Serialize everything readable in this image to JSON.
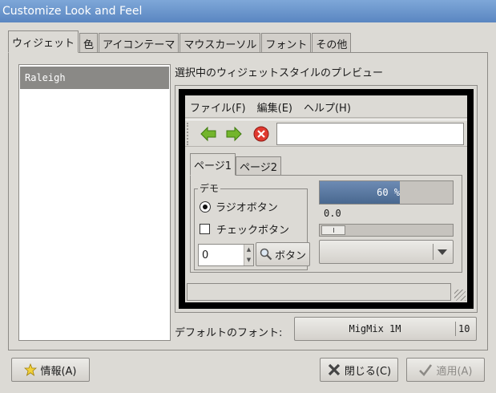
{
  "window": {
    "title": "Customize Look and Feel"
  },
  "tabs": [
    {
      "label": "ウィジェット",
      "active": true
    },
    {
      "label": "色",
      "active": false
    },
    {
      "label": "アイコンテーマ",
      "active": false
    },
    {
      "label": "マウスカーソル",
      "active": false
    },
    {
      "label": "フォント",
      "active": false
    },
    {
      "label": "その他",
      "active": false
    }
  ],
  "theme_list": {
    "items": [
      "Raleigh"
    ],
    "selected": "Raleigh"
  },
  "preview": {
    "label": "選択中のウィジェットスタイルのプレビュー",
    "menu": [
      "ファイル(F)",
      "編集(E)",
      "ヘルプ(H)"
    ],
    "toolbar_icons": [
      "back-arrow-icon",
      "forward-arrow-icon",
      "stop-icon"
    ],
    "notebook_tabs": [
      {
        "label": "ページ1",
        "active": true
      },
      {
        "label": "ページ2",
        "active": false
      }
    ],
    "frame_label": "デモ",
    "radio_label": "ラジオボタン",
    "radio_checked": true,
    "check_label": "チェックボタン",
    "check_checked": false,
    "spin_value": "0",
    "button_label": "ボタン",
    "progress_text": "60 %",
    "progress_fraction": 0.6,
    "scale_value": "0.0"
  },
  "font": {
    "label": "デフォルトのフォント:",
    "name": "MigMix 1M",
    "size": "10"
  },
  "buttons": {
    "about": "情報(A)",
    "close": "閉じる(C)",
    "apply": "適用(A)"
  },
  "colors": {
    "titlebar": "#5a86c1",
    "selection": "#8a8986",
    "progress": "#49688f"
  }
}
